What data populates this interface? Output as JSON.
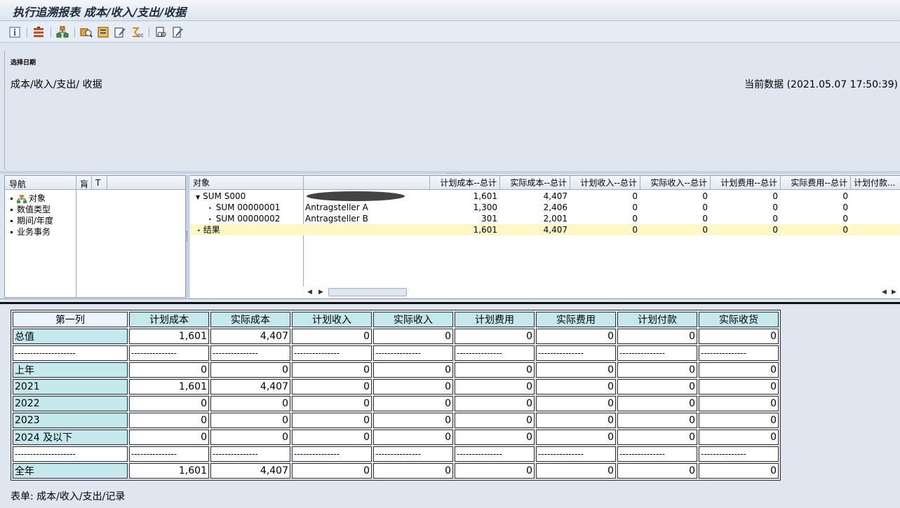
{
  "window": {
    "title": "执行追溯报表 成本/收入/支出/收据"
  },
  "toolbar": {
    "buttons": [
      "info-icon",
      "filter-icon",
      "hierarchy-icon",
      "find-icon",
      "layout-icon",
      "edit-icon",
      "sum-icon",
      "print-preview-icon",
      "change-icon"
    ]
  },
  "header": {
    "label": "选择日期",
    "left_text": "成本/收入/支出/ 收据",
    "right_text": "当前数据 (2021.05.07 17:50:39)"
  },
  "nav": {
    "headers": [
      "导航",
      "肓",
      "T"
    ],
    "items": [
      "对象",
      "数值类型",
      "期间/年度",
      "业务事务"
    ]
  },
  "grid": {
    "columns": [
      "对象",
      "",
      "计划成本--总计",
      "实际成本--总计",
      "计划收入--总计",
      "实际收入--总计",
      "计划费用--总计",
      "实际费用--总计",
      "计划付款..."
    ],
    "rows": [
      {
        "obj": "SUM S000",
        "desc": "",
        "vals": [
          "1,601",
          "4,407",
          "0",
          "0",
          "0",
          "0"
        ]
      },
      {
        "obj": "SUM 00000001",
        "desc": "Antragsteller A",
        "vals": [
          "1,300",
          "2,406",
          "0",
          "0",
          "0",
          "0"
        ]
      },
      {
        "obj": "SUM 00000002",
        "desc": "Antragsteller B",
        "vals": [
          "301",
          "2,001",
          "0",
          "0",
          "0",
          "0"
        ]
      },
      {
        "obj": "结果",
        "desc": "",
        "vals": [
          "1,601",
          "4,407",
          "0",
          "0",
          "0",
          "0"
        ]
      }
    ]
  },
  "report": {
    "headers": [
      "第一列",
      "计划成本",
      "实际成本",
      "计划收入",
      "实际收入",
      "计划费用",
      "实际费用",
      "计划付款",
      "实际收货"
    ],
    "rows": [
      {
        "label": "总值",
        "vals": [
          "1,601",
          "4,407",
          "0",
          "0",
          "0",
          "0",
          "0",
          "0"
        ]
      },
      {
        "label": "--------------------",
        "vals": [
          "---------------",
          "---------------",
          "---------------",
          "---------------",
          "---------------",
          "---------------",
          "---------------",
          "---------------"
        ],
        "dash": true
      },
      {
        "label": "上年",
        "vals": [
          "0",
          "0",
          "0",
          "0",
          "0",
          "0",
          "0",
          "0"
        ]
      },
      {
        "label": "2021",
        "vals": [
          "1,601",
          "4,407",
          "0",
          "0",
          "0",
          "0",
          "0",
          "0"
        ]
      },
      {
        "label": "2022",
        "vals": [
          "0",
          "0",
          "0",
          "0",
          "0",
          "0",
          "0",
          "0"
        ]
      },
      {
        "label": "2023",
        "vals": [
          "0",
          "0",
          "0",
          "0",
          "0",
          "0",
          "0",
          "0"
        ]
      },
      {
        "label": "2024 及以下",
        "vals": [
          "0",
          "0",
          "0",
          "0",
          "0",
          "0",
          "0",
          "0"
        ]
      },
      {
        "label": "--------------------",
        "vals": [
          "---------------",
          "---------------",
          "---------------",
          "---------------",
          "---------------",
          "---------------",
          "---------------",
          "---------------"
        ],
        "dash": true
      },
      {
        "label": "全年",
        "vals": [
          "1,601",
          "4,407",
          "0",
          "0",
          "0",
          "0",
          "0",
          "0"
        ]
      }
    ],
    "footer": "表单: 成本/收入/支出/记录"
  }
}
